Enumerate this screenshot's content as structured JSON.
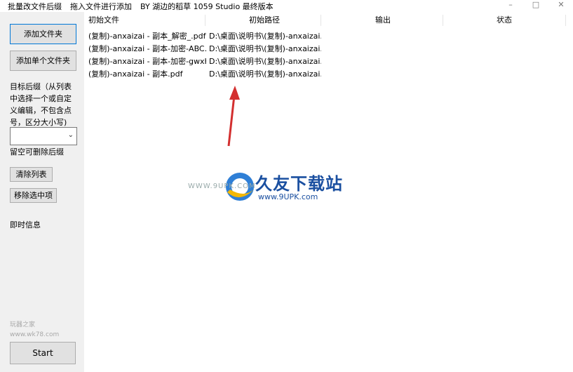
{
  "titlebar": {
    "segment1": "批量改文件后缀",
    "segment2": "拖入文件进行添加",
    "segment3": "BY 湖边的稻草 1059 Studio 最终版本",
    "minimize": "–",
    "maximize": "□",
    "close": "✕"
  },
  "sidebar": {
    "add_folder": "添加文件夹",
    "add_single_folder": "添加单个文件夹",
    "target_suffix_label": "目标后缀（从列表中选择一个或自定义编辑，不包含点号，区分大小写)",
    "target_suffix_lines": [
      "目标后缀（从列表",
      "中选择一个或自定",
      "义编辑，不包含点",
      "号，区分大小写)"
    ],
    "suffix_value": "",
    "leave_empty_hint": "留空可删除后缀",
    "clear_list": "清除列表",
    "remove_selected": "移除选中项",
    "realtime_info": "即时信息",
    "watermark_line1": "玩器之家",
    "watermark_line2": "www.wk78.com",
    "start": "Start"
  },
  "table": {
    "columns": [
      "初始文件",
      "初始路径",
      "输出",
      "状态"
    ],
    "rows": [
      {
        "file": "(复制)-anxaizai - 副本_解密_.pdf",
        "path": "D:\\桌面\\说明书\\(复制)-anxaizai...",
        "output": "",
        "status": ""
      },
      {
        "file": "(复制)-anxaizai - 副本-加密-ABC...",
        "path": "D:\\桌面\\说明书\\(复制)-anxaizai...",
        "output": "",
        "status": ""
      },
      {
        "file": "(复制)-anxaizai - 副本-加密-gwxK...",
        "path": "D:\\桌面\\说明书\\(复制)-anxaizai...",
        "output": "",
        "status": ""
      },
      {
        "file": "(复制)-anxaizai - 副本.pdf",
        "path": "D:\\桌面\\说明书\\(复制)-anxaizai...",
        "output": "",
        "status": ""
      }
    ]
  },
  "overlay": {
    "logo_text": "久友下载站",
    "logo_url": "www.9UPK.com",
    "logo_url_left": "WWW.9UPK.COM",
    "arrow_color": "#d32f2f"
  },
  "colors": {
    "sidebar_bg": "#f0f0f0",
    "button_bg": "#e1e1e1",
    "primary_border": "#0078d7",
    "logo_blue": "#1a4fa0"
  }
}
